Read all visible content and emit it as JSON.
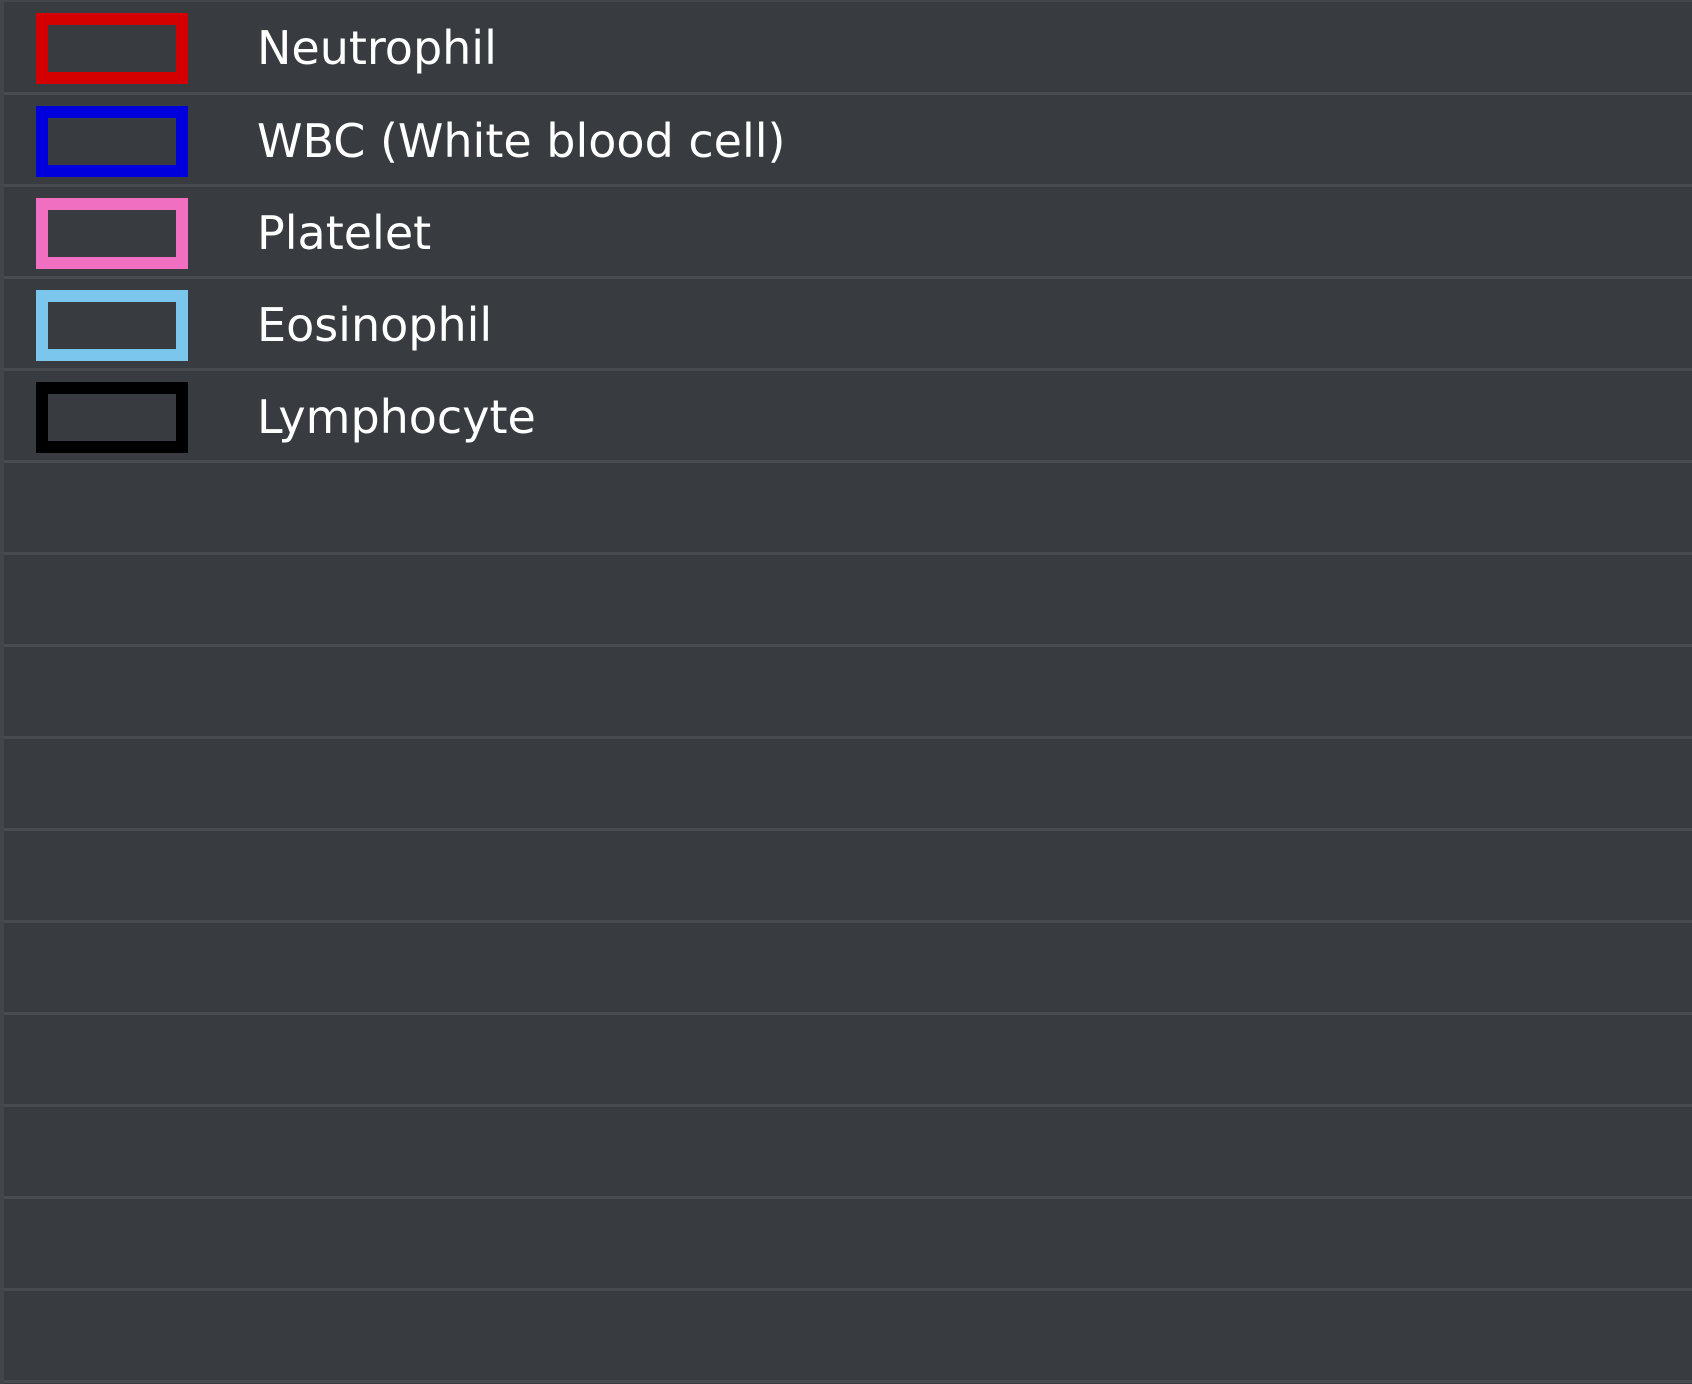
{
  "legend": {
    "items": [
      {
        "label": "Neutrophil",
        "color": "#d40000"
      },
      {
        "label": "WBC (White blood cell)",
        "color": "#0000dd"
      },
      {
        "label": "Platelet",
        "color": "#f06fc0"
      },
      {
        "label": "Eosinophil",
        "color": "#7ac6ec"
      },
      {
        "label": "Lymphocyte",
        "color": "#000000"
      }
    ],
    "empty_rows": 10
  }
}
